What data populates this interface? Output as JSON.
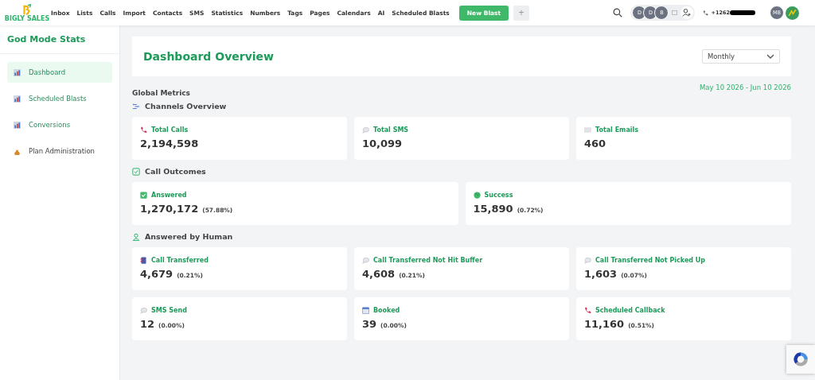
{
  "brand": {
    "name": "BIGLY SALES"
  },
  "nav": [
    {
      "label": "Inbox"
    },
    {
      "label": "Lists"
    },
    {
      "label": "Calls"
    },
    {
      "label": "Import"
    },
    {
      "label": "Contacts"
    },
    {
      "label": "SMS"
    },
    {
      "label": "Statistics"
    },
    {
      "label": "Numbers"
    },
    {
      "label": "Tags"
    },
    {
      "label": "Pages"
    },
    {
      "label": "Calendars"
    },
    {
      "label": "AI"
    },
    {
      "label": "Scheduled Blasts"
    }
  ],
  "new_button": "New Blast",
  "add_button": "+",
  "avatars": [
    "D",
    "D",
    "B"
  ],
  "phone": "+1262",
  "user_avatar": "MB",
  "sidebar": {
    "title": "God Mode Stats",
    "items": [
      {
        "label": "Dashboard",
        "kind": "chart",
        "selected": true
      },
      {
        "label": "Scheduled Blasts",
        "kind": "chart",
        "selected": false
      },
      {
        "label": "Conversions",
        "kind": "chart",
        "selected": false
      },
      {
        "label": "Plan Administration",
        "kind": "bag",
        "selected": false
      }
    ]
  },
  "page_title": "Dashboard Overview",
  "period": {
    "value": "Monthly"
  },
  "global_label": "Global Metrics",
  "date_range": "May 10 2026 - Jun 10 2026",
  "sections": [
    {
      "title": "Channels Overview",
      "kind": "channels",
      "cards": [
        {
          "label": "Total Calls",
          "kind": "phone",
          "value": "2,194,598"
        },
        {
          "label": "Total SMS",
          "kind": "chat",
          "value": "10,099"
        },
        {
          "label": "Total Emails",
          "kind": "mail",
          "value": "460"
        }
      ]
    },
    {
      "title": "Call Outcomes",
      "kind": "check",
      "cards": [
        {
          "label": "Answered",
          "kind": "checkbox",
          "value": "1,270,172",
          "percent": "(57.88%)"
        },
        {
          "label": "Success",
          "kind": "globe",
          "value": "15,890",
          "percent": "(0.72%)"
        }
      ]
    },
    {
      "title": "Answered by Human",
      "kind": "person",
      "cards": [
        {
          "label": "Call Transferred",
          "kind": "book",
          "value": "4,679",
          "percent": "(0.21%)"
        },
        {
          "label": "Call Transferred Not Hit Buffer",
          "kind": "chat",
          "value": "4,608",
          "percent": "(0.21%)"
        },
        {
          "label": "Call Transferred Not Picked Up",
          "kind": "chat",
          "value": "1,603",
          "percent": "(0.07%)"
        },
        {
          "label": "SMS Send",
          "kind": "chat",
          "value": "12",
          "percent": "(0.00%)"
        },
        {
          "label": "Booked",
          "kind": "calendar",
          "value": "39",
          "percent": "(0.00%)"
        },
        {
          "label": "Scheduled Callback",
          "kind": "phone",
          "value": "11,160",
          "percent": "(0.51%)"
        }
      ]
    }
  ]
}
